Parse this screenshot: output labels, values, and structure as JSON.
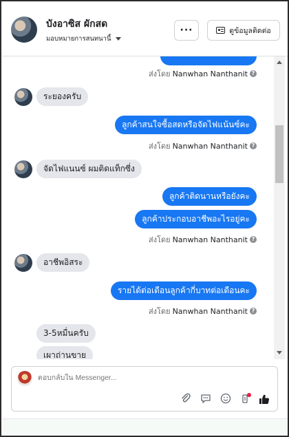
{
  "header": {
    "contact_name": "บังอาซิส ผักสด",
    "assign_label": "มอบหมายการสนทนานี้",
    "more_label": "···",
    "contact_info_label": "ดูข้อมูลติดต่อ"
  },
  "chat": {
    "sent_by_prefix": "ส่งโดย",
    "agent_name": "Nanwhan Nanthanit",
    "messages": [
      {
        "dir": "in",
        "text": "ระยองครับ"
      },
      {
        "dir": "out",
        "text": "ลูกค้าสนใจซื้อสดหรือจัดไฟแน้นซ์คะ"
      },
      {
        "dir": "in",
        "text": "จัดไฟแนนซ์ ผมติดแท็กซี่ง"
      },
      {
        "dir": "out",
        "text": "ลูกค้าติดนานหรือยังคะ"
      },
      {
        "dir": "out",
        "text": "ลูกค้าประกอบอาชีพอะไรอยู่คะ"
      },
      {
        "dir": "in",
        "text": "อาชีพอิสระ"
      },
      {
        "dir": "out",
        "text": "รายได้ต่อเดือนลูกค้ากี่บาทต่อเดือนคะ"
      },
      {
        "dir": "in",
        "text": "3-5หมื่นครับ"
      },
      {
        "dir": "in",
        "text": "เผาถ่านขาย"
      }
    ]
  },
  "composer": {
    "placeholder": "ตอบกลับใน Messenger...",
    "icons": [
      "attachment-icon",
      "saved-reply-icon",
      "emoji-icon",
      "label-icon",
      "like-icon"
    ]
  },
  "colors": {
    "outgoing_bubble": "#1877f2",
    "incoming_bubble": "#e4e6eb",
    "notification_dot": "#e41e3f"
  }
}
